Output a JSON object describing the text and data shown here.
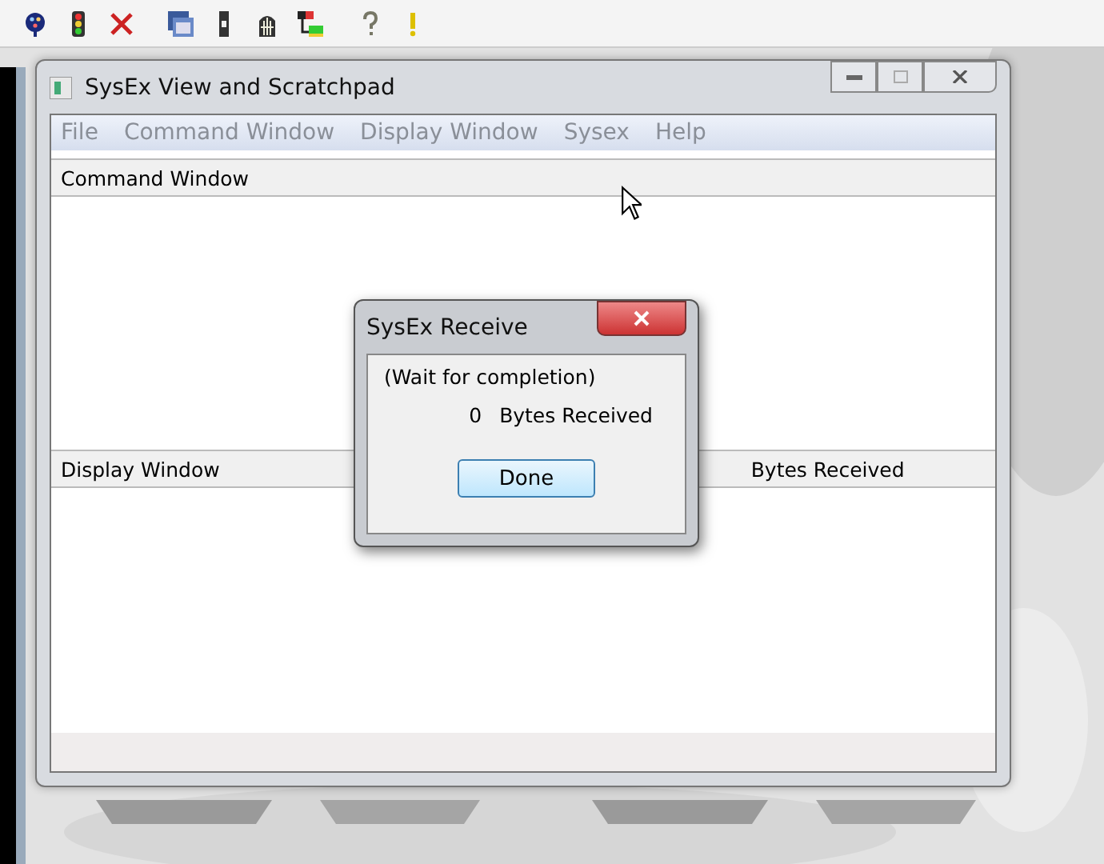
{
  "toolbar": {
    "buttons": [
      {
        "kind": "palette"
      },
      {
        "kind": "traffic"
      },
      {
        "kind": "cross"
      },
      {
        "kind": "windows"
      },
      {
        "kind": "strip"
      },
      {
        "kind": "cage"
      },
      {
        "kind": "tree"
      },
      {
        "kind": "question"
      },
      {
        "kind": "exclaim"
      }
    ]
  },
  "window": {
    "title": "SysEx View and Scratchpad",
    "menu": [
      {
        "label": "File",
        "disabled": true
      },
      {
        "label": "Command Window",
        "disabled": true
      },
      {
        "label": "Display Window",
        "disabled": true
      },
      {
        "label": "Sysex",
        "disabled": true
      },
      {
        "label": "Help",
        "disabled": true
      }
    ],
    "command_pane": {
      "header": "Command Window"
    },
    "display_pane": {
      "header": "Display Window",
      "header_right": "Bytes Received"
    }
  },
  "dialog": {
    "title": "SysEx Receive",
    "status": "(Wait for completion)",
    "count": "0",
    "count_label": "Bytes Received",
    "button": "Done"
  }
}
